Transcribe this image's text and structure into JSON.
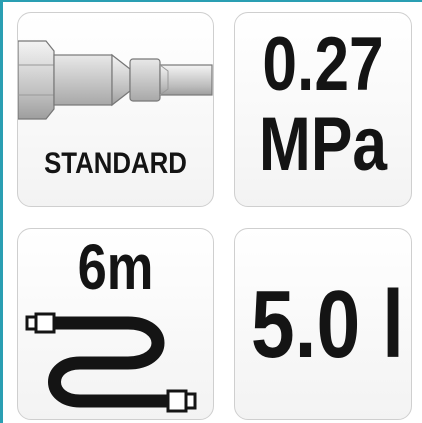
{
  "accent_color": "#2a9fb3",
  "tiles": {
    "connector": {
      "icon": "connector-plug-icon",
      "label": "STANDARD"
    },
    "pressure": {
      "value": "0.27",
      "unit": "MPa"
    },
    "hose": {
      "icon": "coiled-hose-icon",
      "length": "6m"
    },
    "volume": {
      "value": "5.0 l"
    }
  }
}
